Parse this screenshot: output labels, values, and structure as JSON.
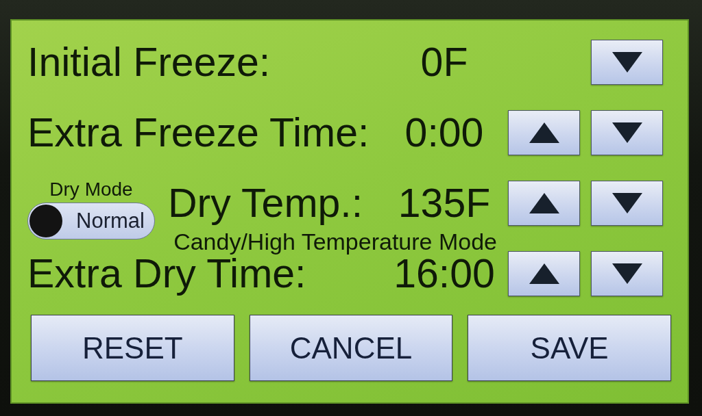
{
  "settings": [
    {
      "label": "Initial Freeze:",
      "value": "0F",
      "steppers": [
        {
          "kind": "down"
        }
      ]
    },
    {
      "label": "Extra Freeze Time:",
      "value": "0:00",
      "steppers": [
        {
          "kind": "up"
        },
        {
          "kind": "down"
        }
      ]
    },
    {
      "mode_switch": {
        "title": "Dry Mode",
        "label": "Normal",
        "on": false
      },
      "label": "Dry Temp.:",
      "value": "135F",
      "steppers": [
        {
          "kind": "up"
        },
        {
          "kind": "down"
        }
      ],
      "note": "Candy/High Temperature Mode"
    },
    {
      "label": "Extra Dry Time:",
      "value": "16:00",
      "steppers": [
        {
          "kind": "up"
        },
        {
          "kind": "down"
        }
      ]
    }
  ],
  "actions": [
    "RESET",
    "CANCEL",
    "SAVE"
  ]
}
